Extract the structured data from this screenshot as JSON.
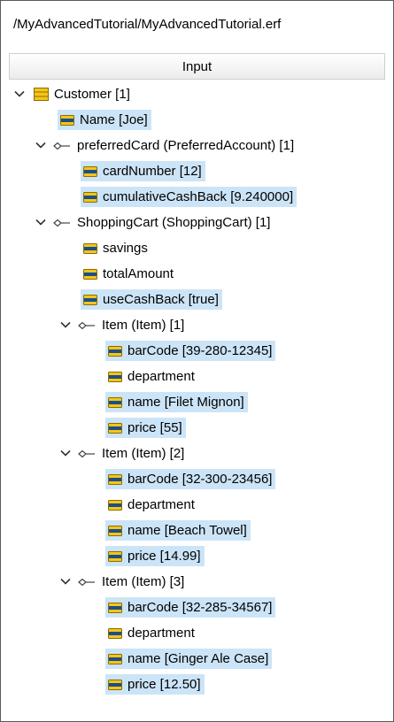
{
  "path": "/MyAdvancedTutorial/MyAdvancedTutorial.erf",
  "header": {
    "title": "Input"
  },
  "colors": {
    "selection": "#cce4f7",
    "field_icon_fill": "#f5c518",
    "field_icon_bar": "#1a4f8b"
  },
  "tree": {
    "customer": "Customer [1]",
    "name": "Name [Joe]",
    "preferred_card": "preferredCard (PreferredAccount) [1]",
    "card_number": "cardNumber [12]",
    "cumulative_cash_back": "cumulativeCashBack [9.240000]",
    "shopping_cart": "ShoppingCart (ShoppingCart) [1]",
    "savings": "savings",
    "total_amount": "totalAmount",
    "use_cash_back": "useCashBack [true]",
    "items": [
      {
        "label": "Item (Item) [1]",
        "bar_code": "barCode [39-280-12345]",
        "department": "department",
        "name": "name [Filet Mignon]",
        "price": "price [55]"
      },
      {
        "label": "Item (Item) [2]",
        "bar_code": "barCode [32-300-23456]",
        "department": "department",
        "name": "name [Beach Towel]",
        "price": "price [14.99]"
      },
      {
        "label": "Item (Item) [3]",
        "bar_code": "barCode [32-285-34567]",
        "department": "department",
        "name": "name [Ginger Ale Case]",
        "price": "price [12.50]"
      }
    ]
  }
}
